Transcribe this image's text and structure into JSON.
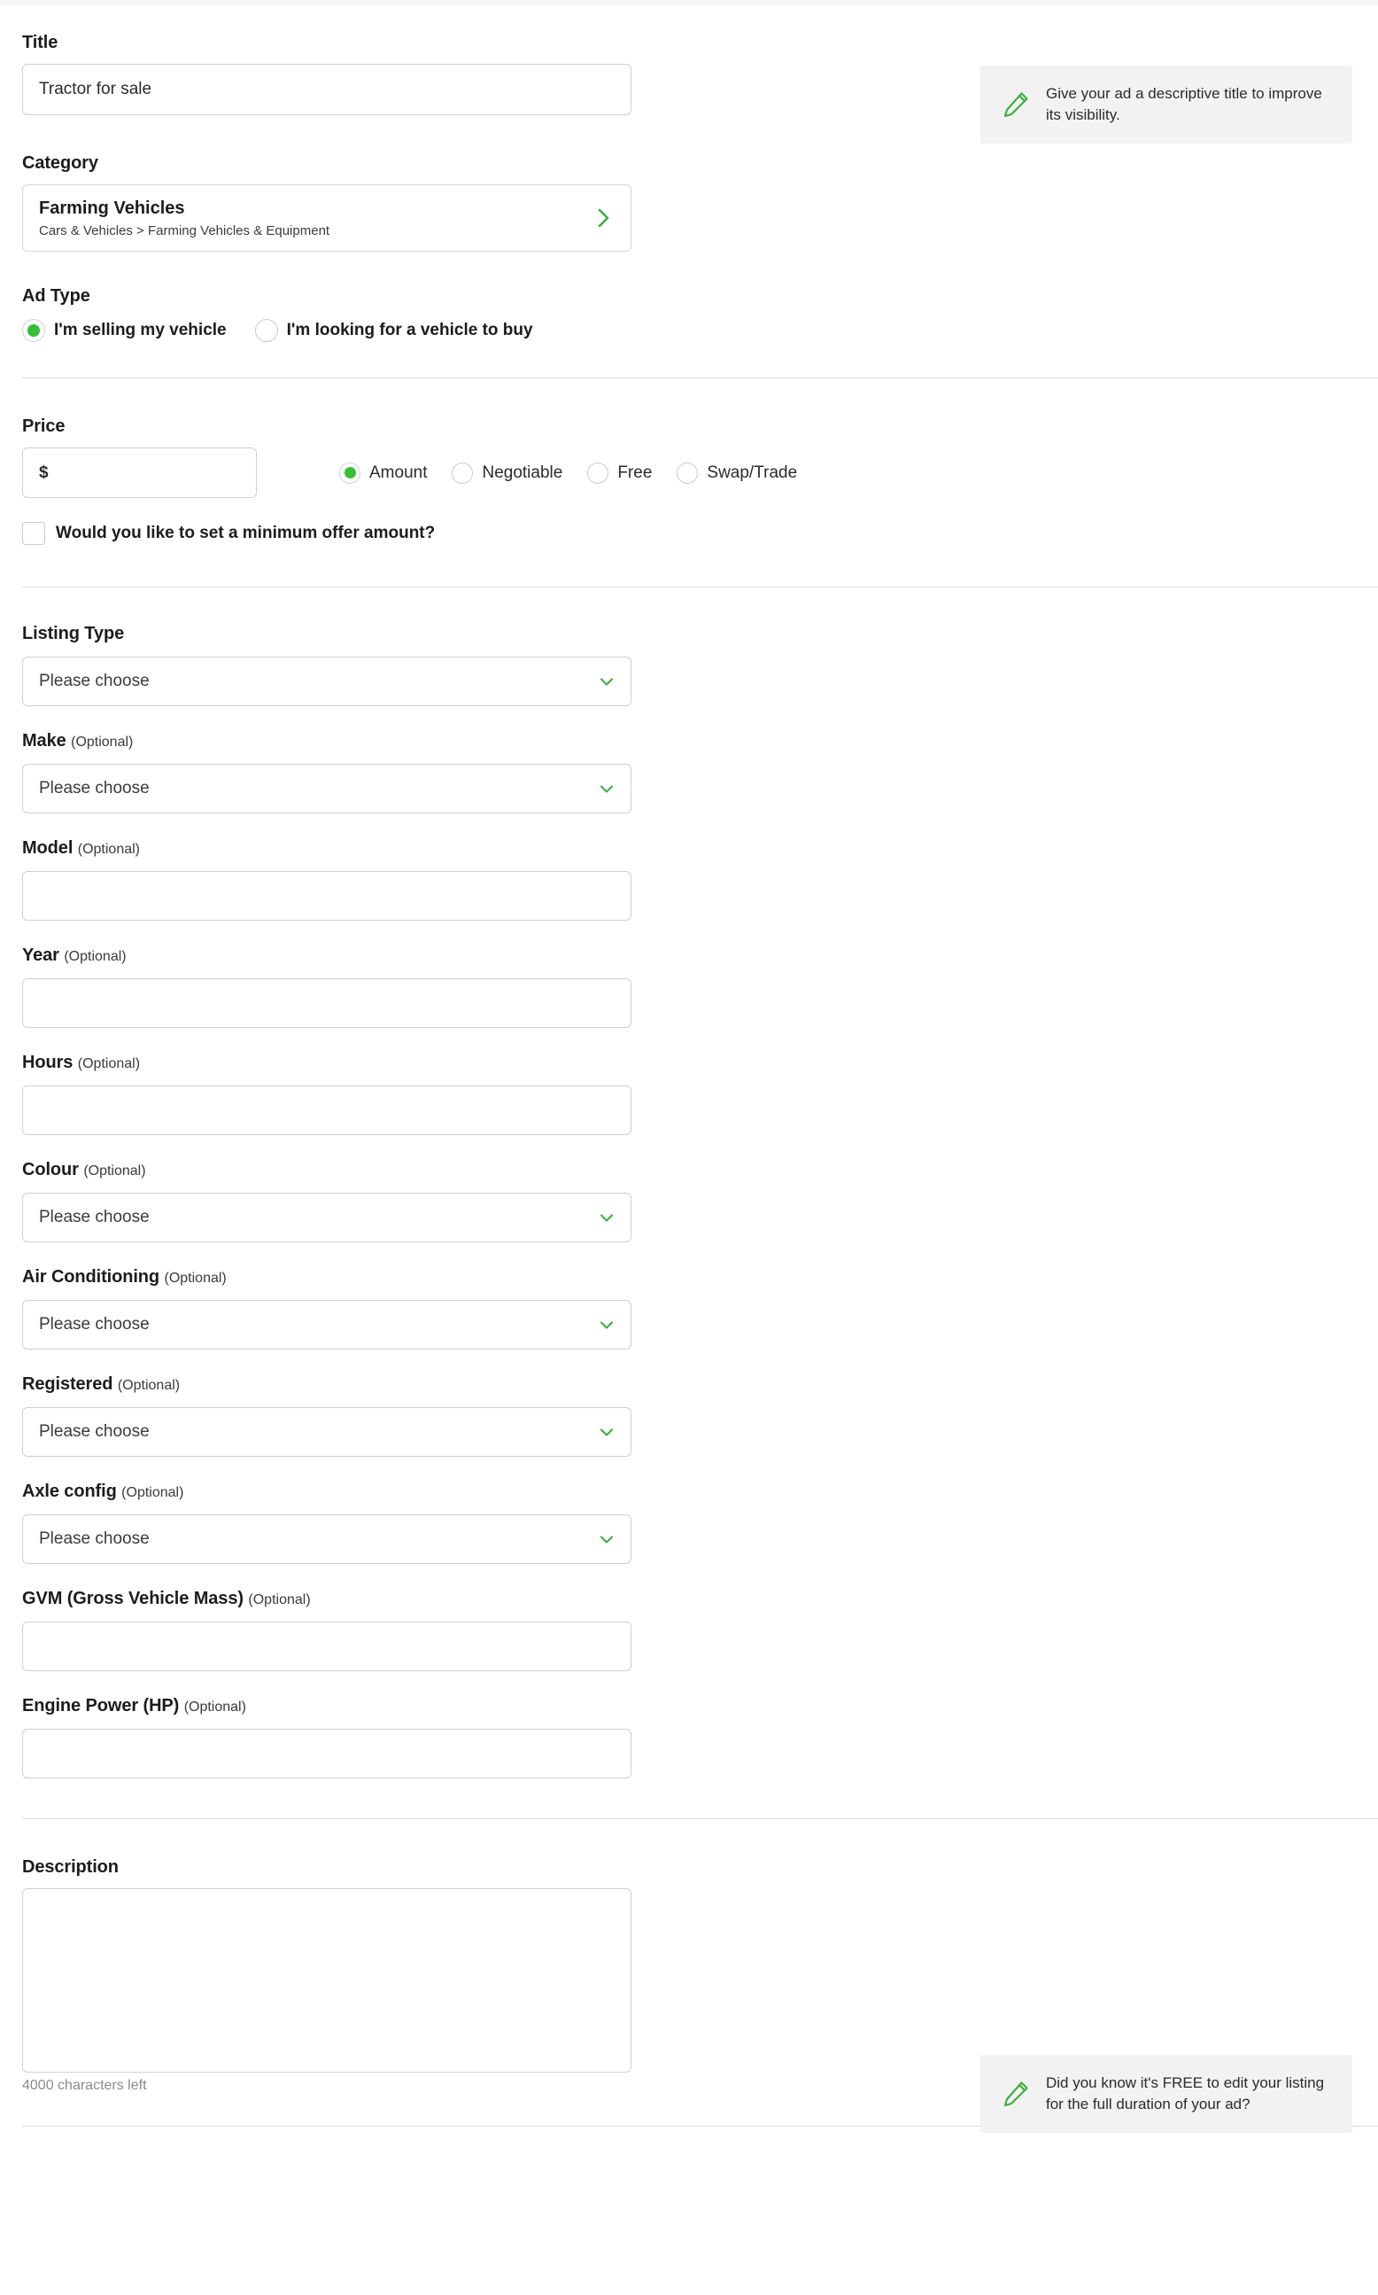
{
  "colors": {
    "accent_green": "#34bf34",
    "chevron_green": "#3fae3f",
    "hint_background": "#f2f2f2",
    "border": "#cfcfcf",
    "divider": "#dcdcdc",
    "text": "#1c1c1c"
  },
  "title_section": {
    "label": "Title",
    "value": "Tractor for sale"
  },
  "hints": {
    "title_hint": "Give your ad a descriptive title to improve its visibility.",
    "description_hint": "Did you know it's FREE to edit your listing for the full duration of your ad?"
  },
  "category_section": {
    "label": "Category",
    "name": "Farming Vehicles",
    "path": "Cars & Vehicles > Farming Vehicles & Equipment"
  },
  "ad_type_section": {
    "label": "Ad Type",
    "options": [
      {
        "label": "I'm selling my vehicle",
        "selected": true
      },
      {
        "label": "I'm looking for a vehicle to buy",
        "selected": false
      }
    ]
  },
  "price_section": {
    "label": "Price",
    "currency_symbol": "$",
    "value": "",
    "options": [
      {
        "label": "Amount",
        "selected": true
      },
      {
        "label": "Negotiable",
        "selected": false
      },
      {
        "label": "Free",
        "selected": false
      },
      {
        "label": "Swap/Trade",
        "selected": false
      }
    ],
    "min_offer_checkbox": {
      "label": "Would you like to set a minimum offer amount?",
      "checked": false
    }
  },
  "attributes": [
    {
      "label": "Listing Type",
      "optional": "",
      "type": "select",
      "value": "Please choose"
    },
    {
      "label": "Make",
      "optional": "(Optional)",
      "type": "select",
      "value": "Please choose"
    },
    {
      "label": "Model",
      "optional": "(Optional)",
      "type": "text",
      "value": ""
    },
    {
      "label": "Year",
      "optional": "(Optional)",
      "type": "text",
      "value": ""
    },
    {
      "label": "Hours",
      "optional": "(Optional)",
      "type": "text",
      "value": ""
    },
    {
      "label": "Colour",
      "optional": "(Optional)",
      "type": "select",
      "value": "Please choose"
    },
    {
      "label": "Air Conditioning",
      "optional": "(Optional)",
      "type": "select",
      "value": "Please choose"
    },
    {
      "label": "Registered",
      "optional": "(Optional)",
      "type": "select",
      "value": "Please choose"
    },
    {
      "label": "Axle config",
      "optional": "(Optional)",
      "type": "select",
      "value": "Please choose"
    },
    {
      "label": "GVM (Gross Vehicle Mass)",
      "optional": "(Optional)",
      "type": "text",
      "value": ""
    },
    {
      "label": "Engine Power (HP)",
      "optional": "(Optional)",
      "type": "text",
      "value": ""
    }
  ],
  "description_section": {
    "label": "Description",
    "value": "",
    "characters_left": "4000 characters left"
  },
  "icons": {
    "chevron_right": "chevron-right-icon",
    "chevron_down": "chevron-down-icon",
    "pencil": "pencil-icon"
  }
}
